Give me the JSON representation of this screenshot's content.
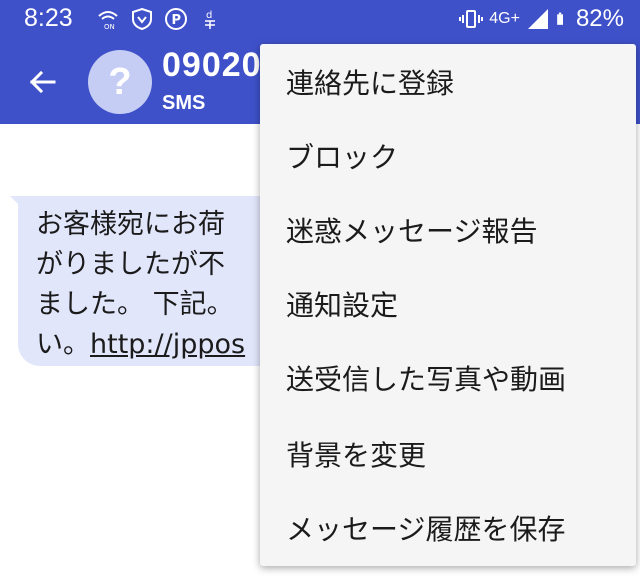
{
  "status_bar": {
    "time": "8:23",
    "network": "4G+",
    "battery": "82%",
    "icons": [
      "wifi-calling-icon",
      "shield-icon",
      "parking-icon",
      "d-app-icon",
      "vibrate-icon",
      "signal-icon",
      "battery-icon"
    ]
  },
  "conversation": {
    "contact_number": "09020",
    "contact_sub": "SMS",
    "avatar_glyph": "?"
  },
  "message": {
    "lines": [
      "お客様宛にお荷",
      "がりましたが不",
      "ました。 下記。",
      "い。"
    ],
    "link": "http://jppos"
  },
  "menu": {
    "items": [
      "連絡先に登録",
      "ブロック",
      "迷惑メッセージ報告",
      "通知設定",
      "送受信した写真や動画",
      "背景を変更",
      "メッセージ履歴を保存"
    ]
  },
  "colors": {
    "app_bar": "#3f51c9",
    "bubble": "#e2e6fb",
    "menu": "#f5f5f5"
  }
}
